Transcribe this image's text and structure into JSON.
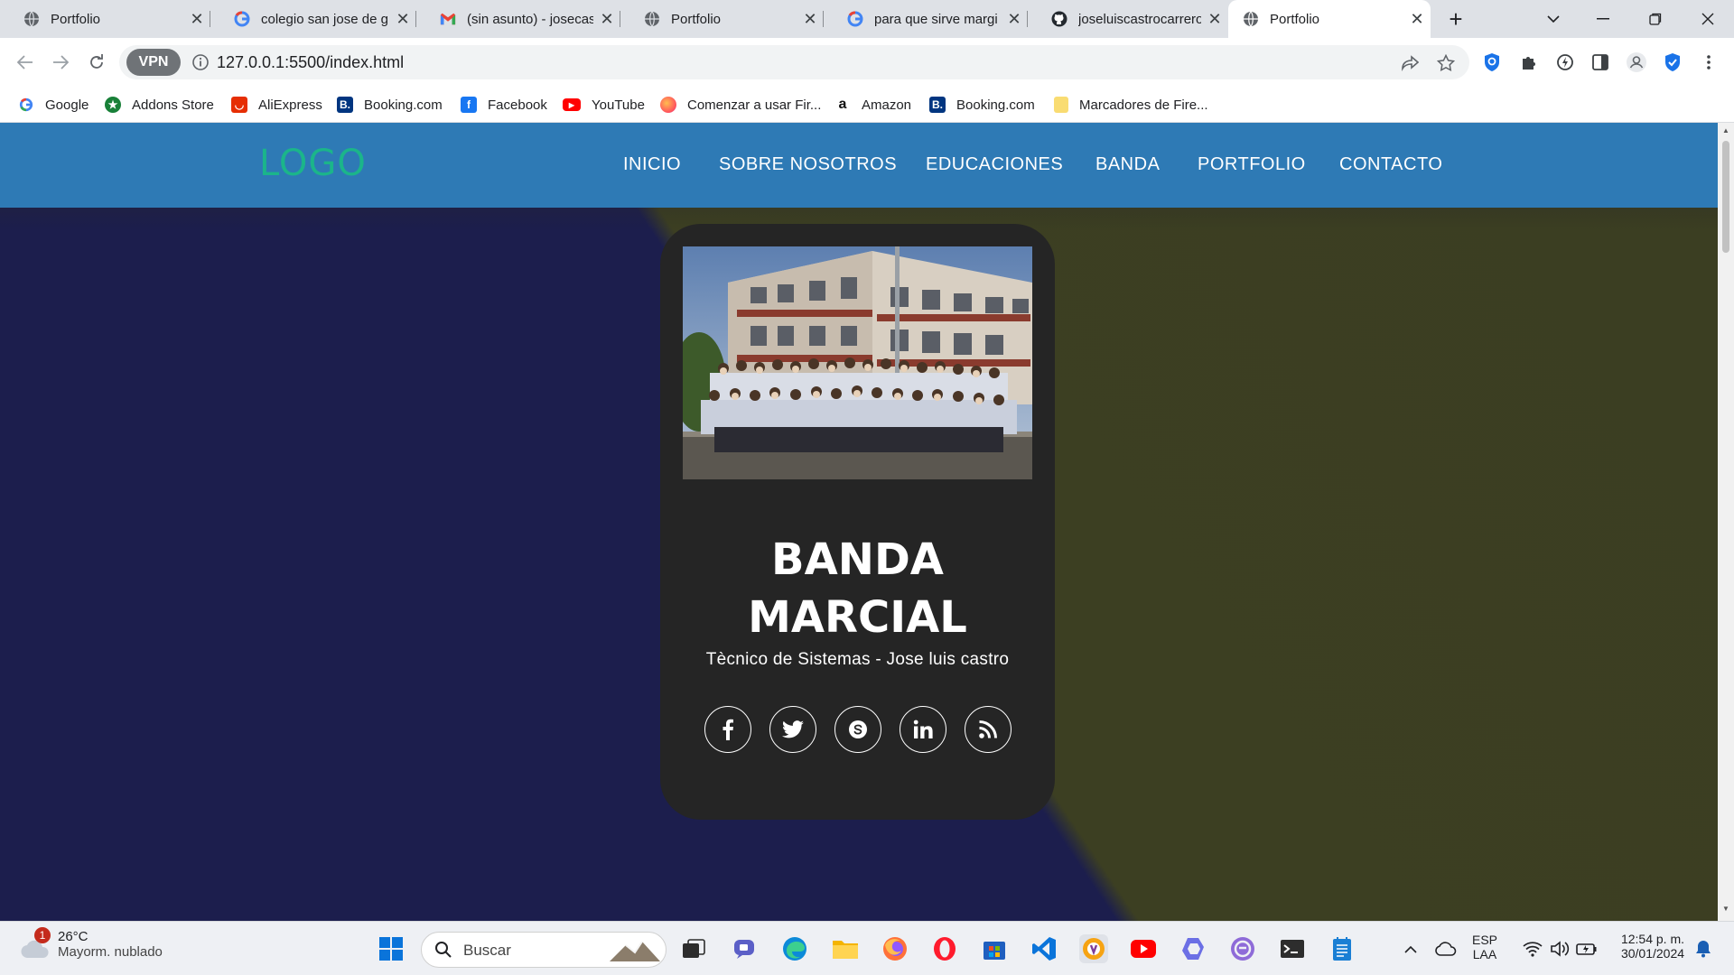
{
  "browser": {
    "tabs": [
      {
        "label": "Portfolio",
        "icon": "globe-icon"
      },
      {
        "label": "colegio san jose de g",
        "icon": "google-icon"
      },
      {
        "label": "(sin asunto) - josecas",
        "icon": "gmail-icon"
      },
      {
        "label": "Portfolio",
        "icon": "globe-icon"
      },
      {
        "label": "para que sirve margi",
        "icon": "google-icon"
      },
      {
        "label": "joseluiscastrocarrero",
        "icon": "github-icon"
      },
      {
        "label": "Portfolio",
        "icon": "globe-icon"
      }
    ],
    "active_tab_index": 6,
    "vpn_label": "VPN",
    "url": "127.0.0.1:5500/index.html",
    "bookmarks": [
      {
        "label": "Google",
        "icon": "google-icon",
        "color": "#4285f4"
      },
      {
        "label": "Addons Store",
        "icon": "addons-icon",
        "color": "#188038"
      },
      {
        "label": "AliExpress",
        "icon": "aliexpress-icon",
        "color": "#e62e04"
      },
      {
        "label": "Booking.com",
        "icon": "booking-icon",
        "color": "#003580"
      },
      {
        "label": "Facebook",
        "icon": "facebook-icon",
        "color": "#1877f2"
      },
      {
        "label": "YouTube",
        "icon": "youtube-icon",
        "color": "#ff0000"
      },
      {
        "label": "Comenzar a usar Fir...",
        "icon": "firefox-icon",
        "color": "#ff7139"
      },
      {
        "label": "Amazon",
        "icon": "amazon-icon",
        "color": "#111111"
      },
      {
        "label": "Booking.com",
        "icon": "booking-icon",
        "color": "#003580"
      },
      {
        "label": "Marcadores de Fire...",
        "icon": "folder-icon",
        "color": "#f9dc72"
      }
    ]
  },
  "site": {
    "logo": "LOGO",
    "nav": [
      "INICIO",
      "SOBRE NOSOTROS",
      "EDUCACIONES",
      "BANDA",
      "PORTFOLIO",
      "CONTACTO"
    ],
    "card": {
      "title_line1": "BANDA",
      "title_line2": "MARCIAL",
      "subtitle": "Tècnico de Sistemas - Jose luis castro",
      "social": [
        "facebook-icon",
        "twitter-icon",
        "skype-icon",
        "linkedin-icon",
        "rss-icon"
      ]
    },
    "colors": {
      "nav_bg": "#2e7ab5",
      "logo": "#1bb58a",
      "card_bg": "#252525"
    }
  },
  "taskbar": {
    "weather_temp": "26°C",
    "weather_desc": "Mayorm. nublado",
    "weather_badge": "1",
    "search_placeholder": "Buscar",
    "language_1": "ESP",
    "language_2": "LAA",
    "time": "12:54 p. m.",
    "date": "30/01/2024"
  }
}
